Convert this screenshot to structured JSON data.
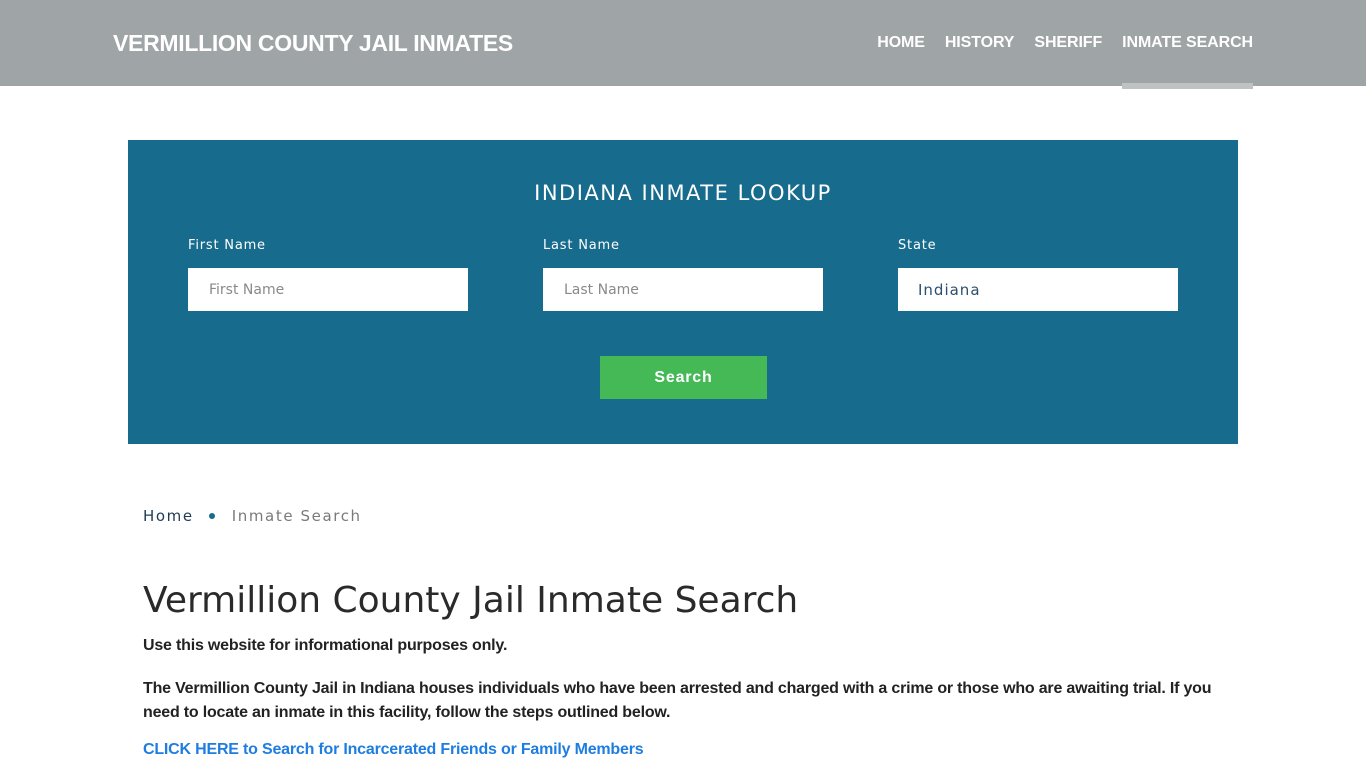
{
  "header": {
    "brand": "VERMILLION COUNTY JAIL INMATES",
    "nav": [
      {
        "label": "HOME",
        "active": false
      },
      {
        "label": "HISTORY",
        "active": false
      },
      {
        "label": "SHERIFF",
        "active": false
      },
      {
        "label": "INMATE SEARCH",
        "active": true
      }
    ]
  },
  "lookup": {
    "title": "INDIANA INMATE LOOKUP",
    "first_name": {
      "label": "First Name",
      "placeholder": "First Name",
      "value": ""
    },
    "last_name": {
      "label": "Last Name",
      "placeholder": "Last Name",
      "value": ""
    },
    "state": {
      "label": "State",
      "value": "Indiana"
    },
    "search_label": "Search"
  },
  "breadcrumb": {
    "home": "Home",
    "current": "Inmate Search"
  },
  "content": {
    "title": "Vermillion County Jail Inmate Search",
    "disclaimer": "Use this website for informational purposes only.",
    "intro": "The Vermillion County Jail in Indiana houses individuals who have been arrested and charged with a crime or those who are awaiting trial. If you need to locate an inmate in this facility, follow the steps outlined below.",
    "cta": "CLICK HERE to Search for Incarcerated Friends or Family Members"
  },
  "colors": {
    "header_bg": "#9fa4a7",
    "panel_bg": "#176b8d",
    "button_bg": "#46b957",
    "link": "#1e7de0"
  }
}
